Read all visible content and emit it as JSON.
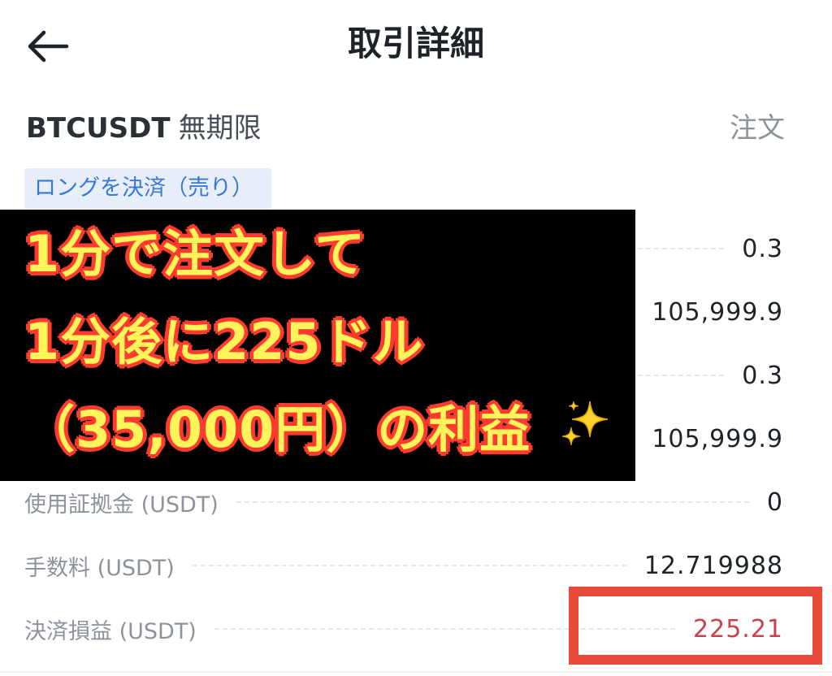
{
  "header": {
    "title": "取引詳細",
    "back_icon": "arrow-left-icon"
  },
  "order": {
    "symbol": "BTCUSDT",
    "contract_type": "無期限",
    "order_type": "注文",
    "side_badge": "ロングを決済（売り）"
  },
  "details": {
    "rows": [
      {
        "label": "",
        "value": "0.3"
      },
      {
        "label": "",
        "value": "105,999.9"
      },
      {
        "label": "",
        "value": "0.3"
      },
      {
        "label": "",
        "value": "105,999.9"
      },
      {
        "label": "使用証拠金 (USDT)",
        "value": "0"
      },
      {
        "label": "手数料 (USDT)",
        "value": "12.719988"
      },
      {
        "label": "決済損益 (USDT)",
        "value": "225.21"
      }
    ]
  },
  "overlay": {
    "line1": "1分で注文して",
    "line2": "1分後に225ドル",
    "line3": "（35,000円）の利益",
    "sparkle_icon": "sparkles-icon"
  },
  "colors": {
    "profit": "#c8424d",
    "badge_bg": "#e8eef9",
    "badge_text": "#3a78d8",
    "caption_fill": "#fff45a",
    "caption_stroke": "#ff3b2f",
    "highlight": "#ea4a3c"
  }
}
